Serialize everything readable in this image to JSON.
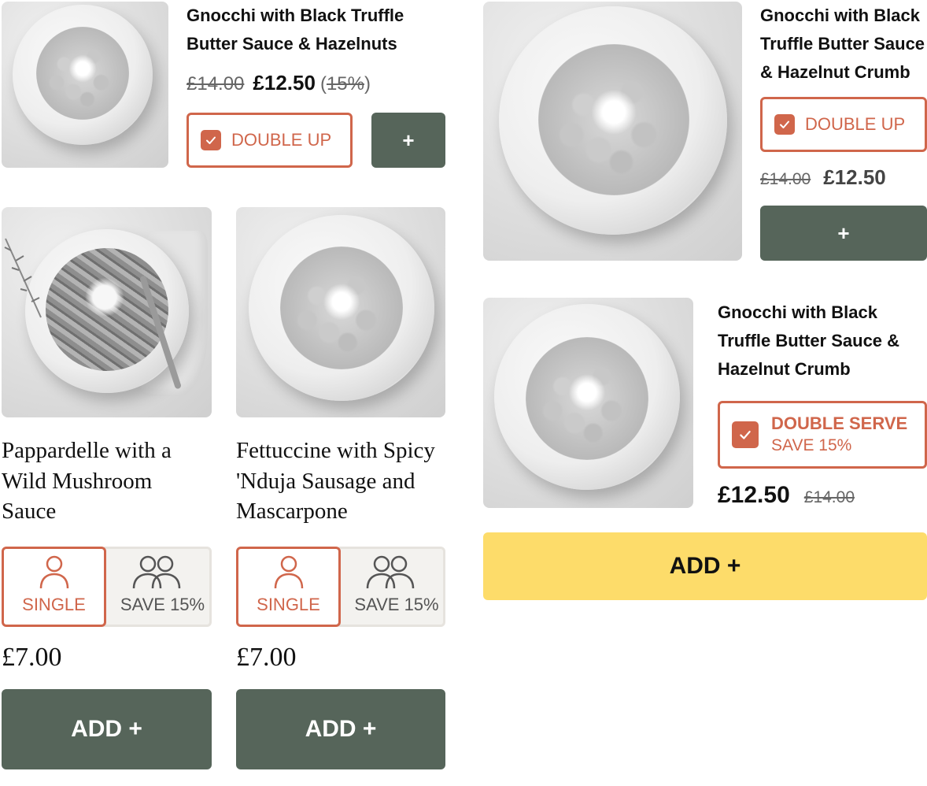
{
  "colors": {
    "accent": "#d0664b",
    "green": "#56655a",
    "yellow": "#fddc6a"
  },
  "card_a": {
    "title_line1": "Gnocchi with Black Truffle",
    "title_line2": "Butter Sauce & Hazelnuts",
    "price_old": "£14.00",
    "price_new": "£12.50",
    "discount_open": "(",
    "discount": "15%",
    "discount_close": ")",
    "double_label": "DOUBLE UP",
    "add_label": "+"
  },
  "card_b": {
    "title_line1": "Pappardelle with a",
    "title_line2": "Wild Mushroom",
    "title_line3": "Sauce",
    "single_label": "SINGLE",
    "save_label": "SAVE 15%",
    "price": "£7.00",
    "add_label": "ADD +"
  },
  "card_c": {
    "title_line1": "Fettuccine with Spicy",
    "title_line2": "'Nduja Sausage and",
    "title_line3": "Mascarpone",
    "single_label": "SINGLE",
    "save_label": "SAVE 15%",
    "price": "£7.00",
    "add_label": "ADD +"
  },
  "card_d": {
    "title_line1": "Gnocchi with Black",
    "title_line2": "Truffle Butter Sauce",
    "title_line3": "& Hazelnut Crumb",
    "double_label": "DOUBLE UP",
    "price_old": "£14.00",
    "price_new": "£12.50",
    "add_label": "+"
  },
  "card_e": {
    "title_line1": "Gnocchi with Black",
    "title_line2": "Truffle Butter Sauce &",
    "title_line3": "Hazelnut Crumb",
    "double_label": "DOUBLE SERVE",
    "save_label": "SAVE 15%",
    "price_new": "£12.50",
    "price_old": "£14.00",
    "add_label": "ADD +"
  }
}
